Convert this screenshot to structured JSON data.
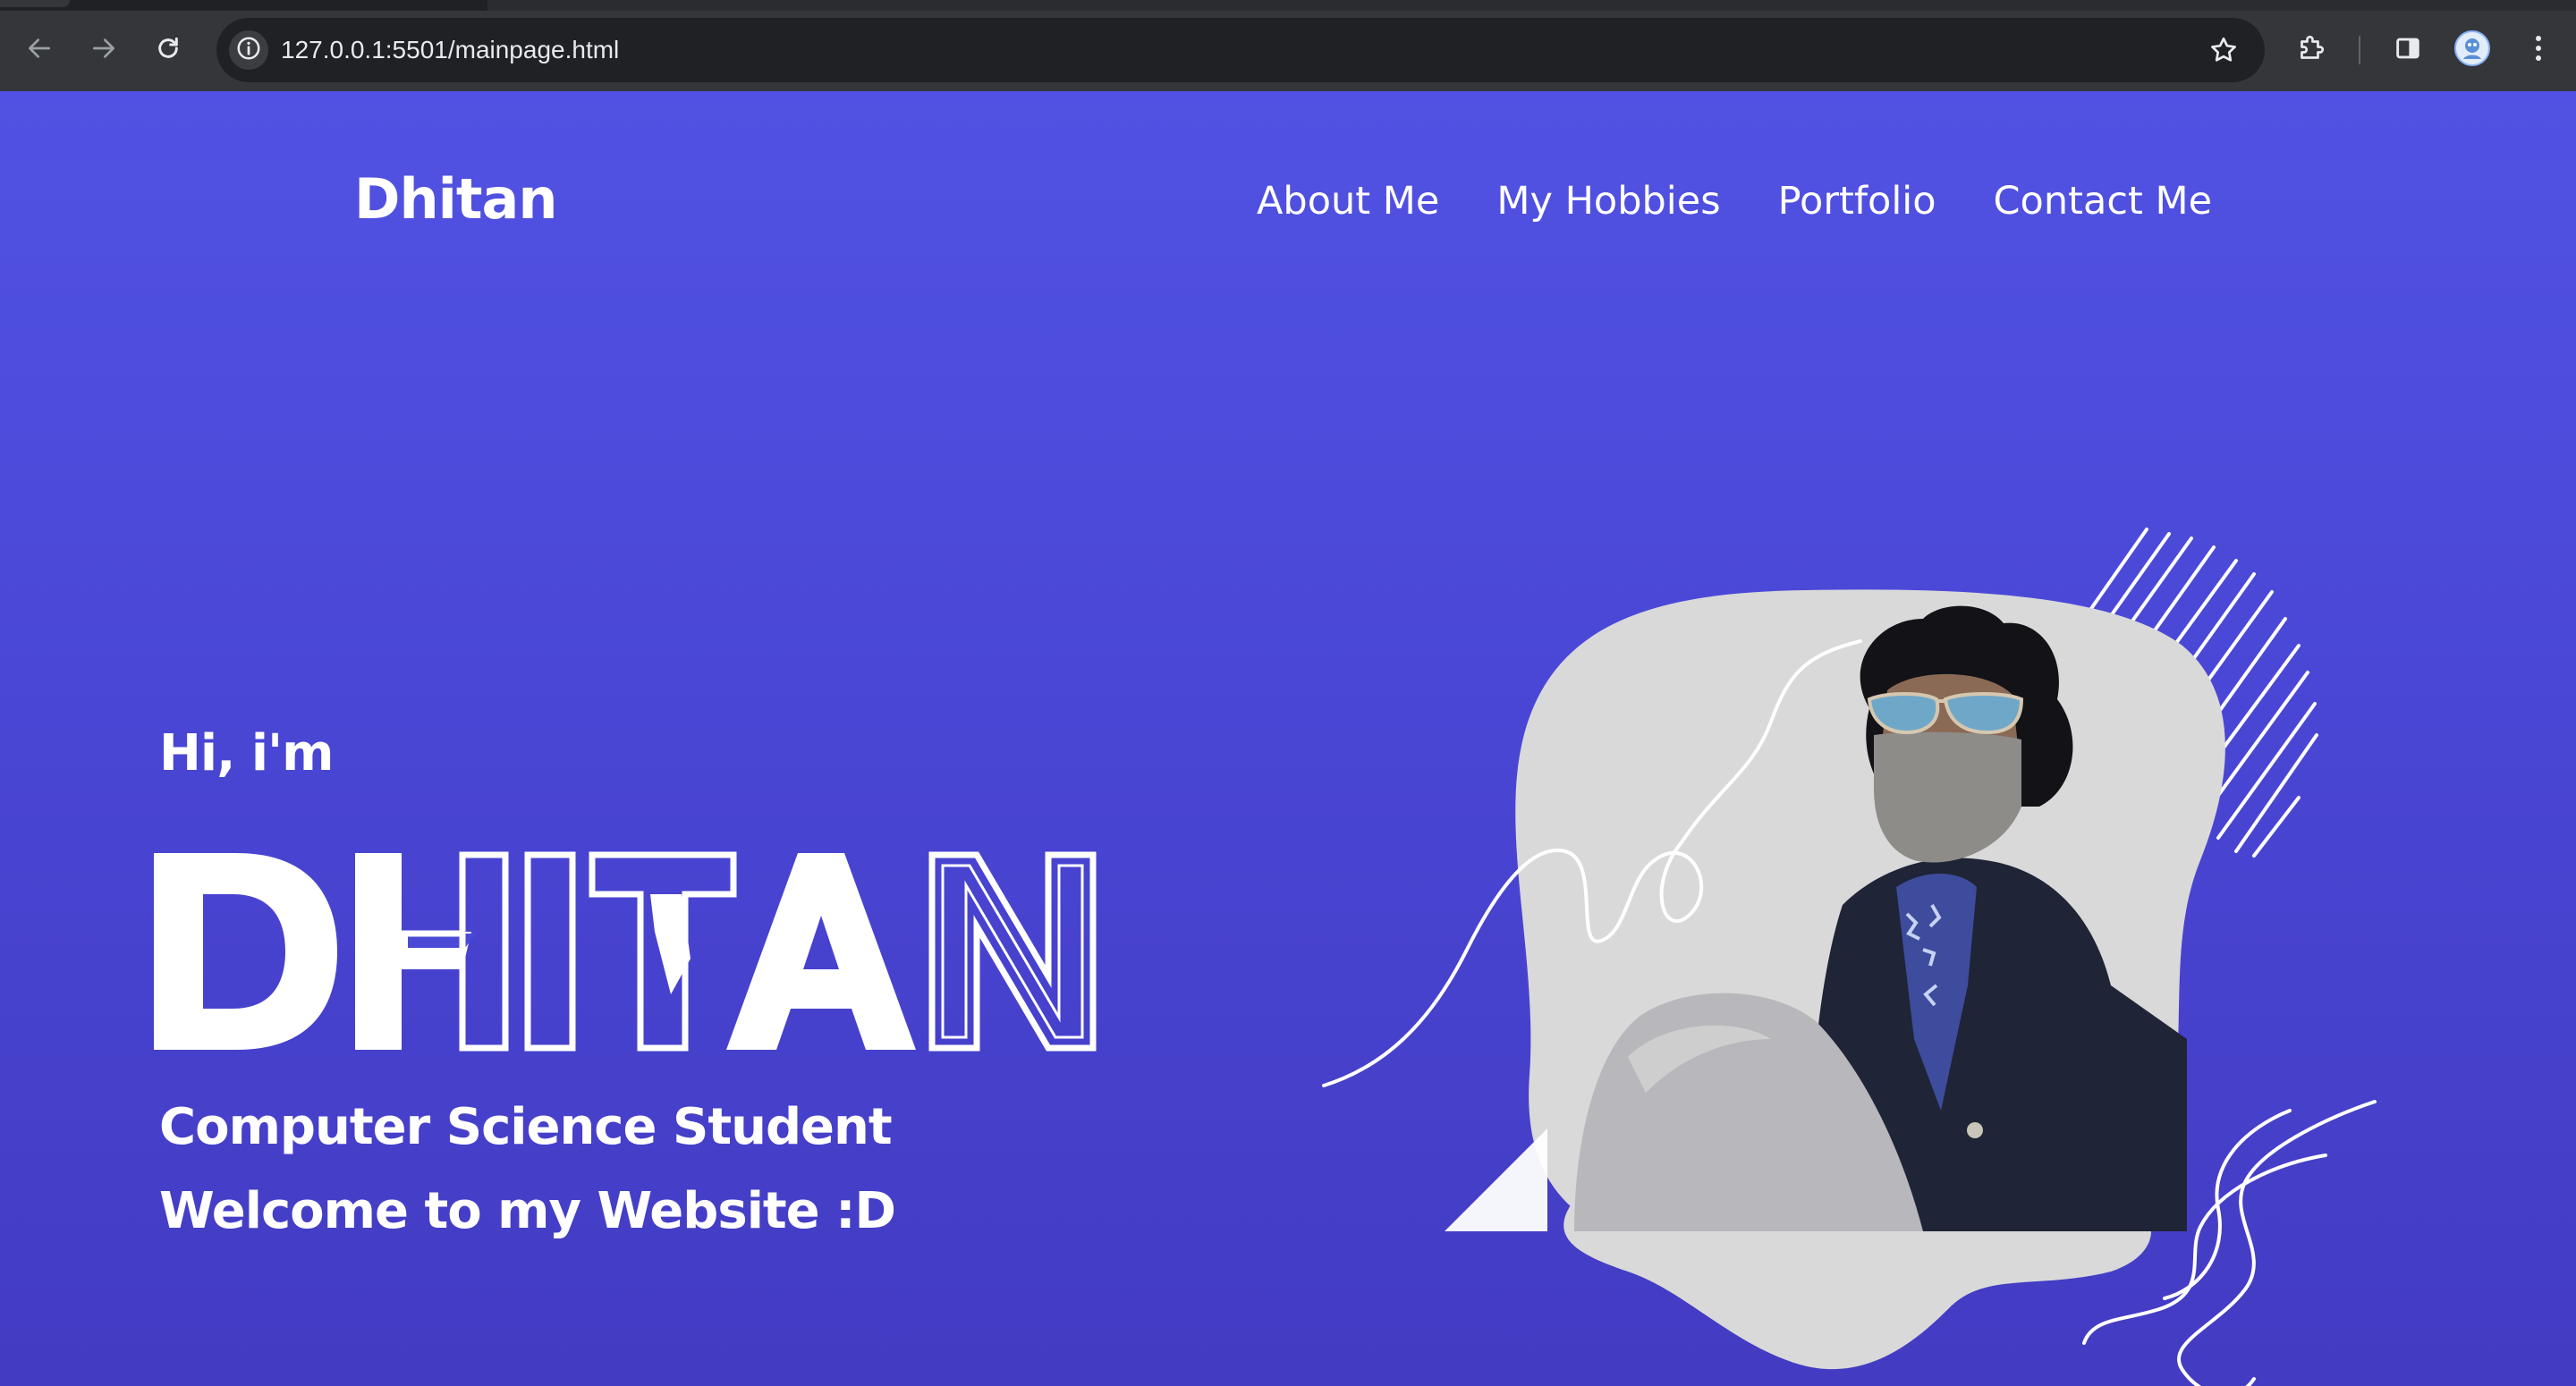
{
  "browser": {
    "url": "127.0.0.1:5501/mainpage.html",
    "icons": [
      "back-arrow-icon",
      "forward-arrow-icon",
      "reload-icon",
      "site-info-icon",
      "bookmark-star-icon",
      "extensions-icon",
      "side-panel-icon",
      "profile-avatar-icon",
      "more-menu-icon"
    ]
  },
  "header": {
    "brand": "Dhitan",
    "nav": [
      {
        "label": "About Me"
      },
      {
        "label": "My Hobbies"
      },
      {
        "label": "Portfolio"
      },
      {
        "label": "Contact Me"
      }
    ]
  },
  "hero": {
    "greeting": "Hi, i'm",
    "name": "DHITAN",
    "subtitle": "Computer Science Student",
    "welcome": "Welcome to my Website :D"
  },
  "colors": {
    "page_top": "#5152e3",
    "page_bottom": "#433bc2",
    "text": "#ffffff",
    "blob": "#d9d9d9"
  }
}
